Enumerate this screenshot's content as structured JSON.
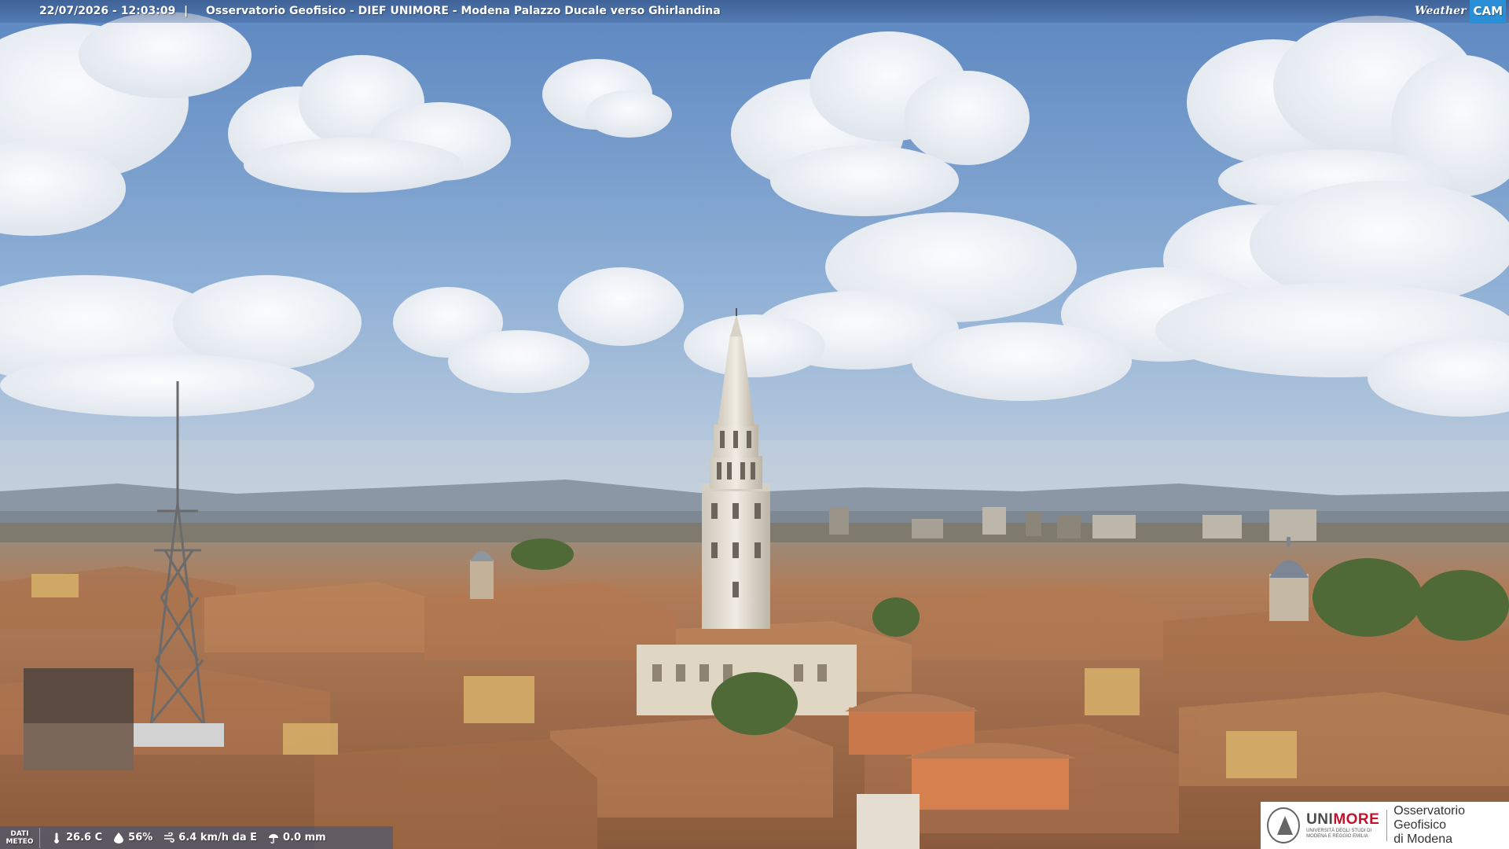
{
  "overlay": {
    "datetime": "22/07/2026 - 12:03:09",
    "separator": "|",
    "caption": "Osservatorio Geofisico - DIEF UNIMORE - Modena Palazzo Ducale verso Ghirlandina"
  },
  "webcam_logo": {
    "weather": "Weather",
    "cam": "CAM"
  },
  "meteo": {
    "label_line1": "DATI",
    "label_line2": "METEO",
    "temperature": "26.6 C",
    "humidity": "56%",
    "wind": "6.4 km/h da E",
    "rain": "0.0 mm",
    "icons": [
      "thermometer-icon",
      "humidity-drop-icon",
      "wind-icon",
      "rain-icon"
    ]
  },
  "unimore_logo": {
    "brand_uni": "UNI",
    "brand_more": "MORE",
    "brand_sub_1": "UNIVERSITÀ DEGLI STUDI DI",
    "brand_sub_2": "MODENA E REGGIO EMILIA",
    "obs_line1": "Osservatorio Geofisico",
    "obs_line2": "di Modena"
  },
  "colors": {
    "sky_top": "#5f88c2",
    "sky_bottom": "#b7c8dc",
    "roof": "#b97a52",
    "tower": "#e6e1d6",
    "accent_red": "#c8102e",
    "webcam_blue": "#2a8fd6"
  }
}
